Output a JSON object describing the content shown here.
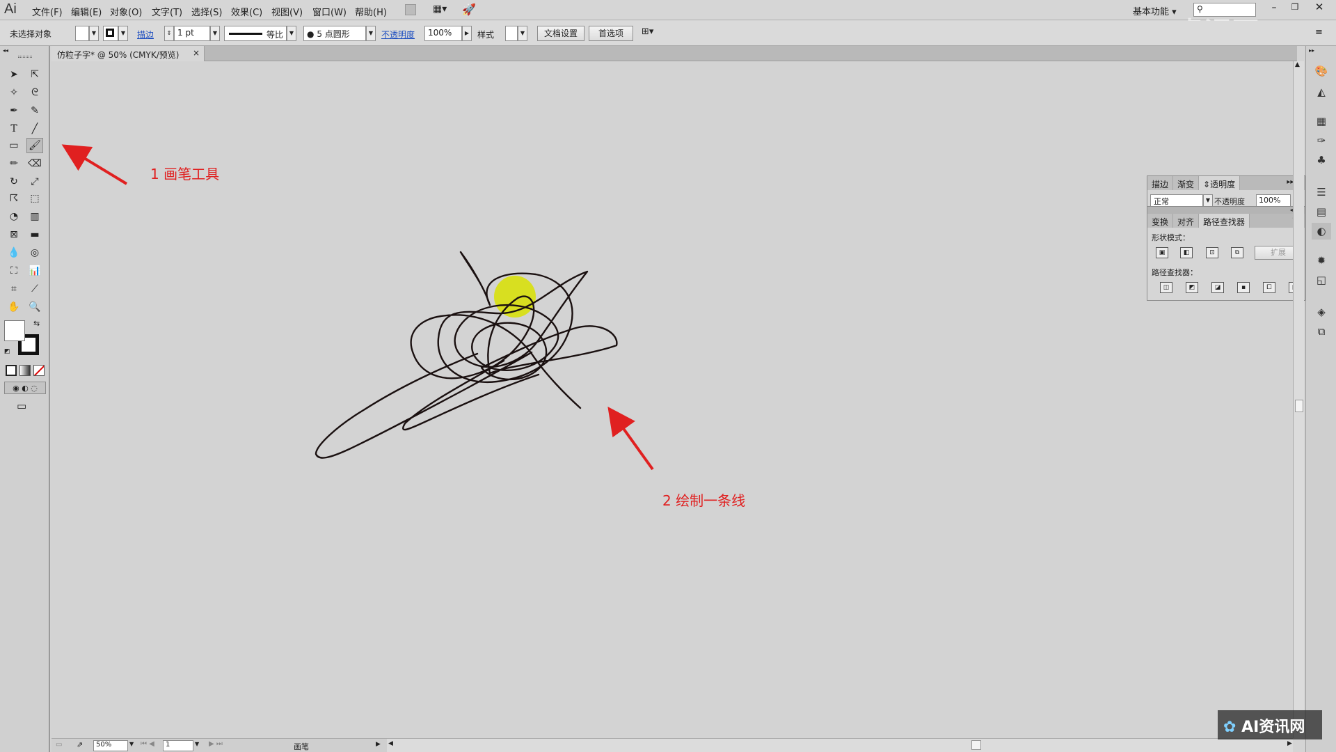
{
  "app": {
    "logo": "Ai"
  },
  "menu": {
    "items": [
      "文件(F)",
      "编辑(E)",
      "对象(O)",
      "文字(T)",
      "选择(S)",
      "效果(C)",
      "视图(V)",
      "窗口(W)",
      "帮助(H)"
    ],
    "workspace": "基本功能",
    "search_placeholder": ""
  },
  "control_bar": {
    "selection_status": "未选择对象",
    "stroke_label": "描边",
    "stroke_weight": "1 pt",
    "stroke_profile": "等比",
    "brush_def": "5 点圆形",
    "opacity_label": "不透明度",
    "opacity_value": "100%",
    "style_label": "样式",
    "doc_setup_button": "文档设置",
    "preferences_button": "首选项"
  },
  "document": {
    "tab_title": "仿粒子字* @ 50% (CMYK/预览)",
    "close_glyph": "×"
  },
  "annotations": {
    "step1": "1 画笔工具",
    "step2": "2 绘制一条线"
  },
  "transparency_panel": {
    "tabs": [
      "描边",
      "渐变",
      "透明度"
    ],
    "blend_mode": "正常",
    "opacity_label": "不透明度",
    "opacity_value": "100%"
  },
  "pathfinder_panel": {
    "tabs": [
      "变换",
      "对齐",
      "路径查找器"
    ],
    "shape_modes_label": "形状模式：",
    "expand_button": "扩展",
    "pathfinders_label": "路径查找器："
  },
  "status_bar": {
    "zoom": "50%",
    "page": "1",
    "tool_name": "画笔"
  },
  "watermarks": {
    "top_right": "虎课网",
    "bottom_right": "AI资讯网"
  },
  "colors": {
    "annotation_red": "#e02020",
    "highlight_yellow": "#d8e000",
    "link_blue": "#1f4fc0"
  }
}
